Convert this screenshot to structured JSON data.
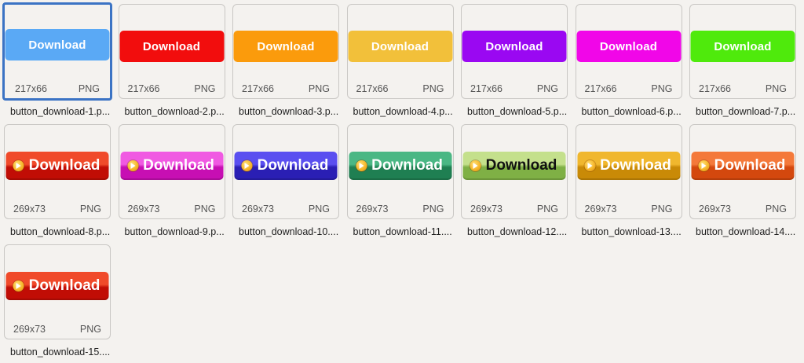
{
  "files": [
    {
      "name": "button_download-1.p...",
      "dims": "217x66",
      "type": "PNG",
      "label": "Download",
      "style": "flat",
      "bg": "#5aa9f5",
      "selected": true
    },
    {
      "name": "button_download-2.p...",
      "dims": "217x66",
      "type": "PNG",
      "label": "Download",
      "style": "flat",
      "bg": "#f20d0d"
    },
    {
      "name": "button_download-3.p...",
      "dims": "217x66",
      "type": "PNG",
      "label": "Download",
      "style": "flat",
      "bg": "#fb9b0c"
    },
    {
      "name": "button_download-4.p...",
      "dims": "217x66",
      "type": "PNG",
      "label": "Download",
      "style": "flat",
      "bg": "#f2c03a"
    },
    {
      "name": "button_download-5.p...",
      "dims": "217x66",
      "type": "PNG",
      "label": "Download",
      "style": "flat",
      "bg": "#9a08f2"
    },
    {
      "name": "button_download-6.p...",
      "dims": "217x66",
      "type": "PNG",
      "label": "Download",
      "style": "flat",
      "bg": "#f106e8"
    },
    {
      "name": "button_download-7.p...",
      "dims": "217x66",
      "type": "PNG",
      "label": "Download",
      "style": "flat",
      "bg": "#4fea0c"
    },
    {
      "name": "button_download-8.p...",
      "dims": "269x73",
      "type": "PNG",
      "label": "Download",
      "style": "glossy",
      "top": "#f04a2a",
      "bottom": "#c10d05",
      "text": "#ffffff"
    },
    {
      "name": "button_download-9.p...",
      "dims": "269x73",
      "type": "PNG",
      "label": "Download",
      "style": "glossy",
      "top": "#f05ae2",
      "bottom": "#c70fb3",
      "text": "#ffffff"
    },
    {
      "name": "button_download-10....",
      "dims": "269x73",
      "type": "PNG",
      "label": "Download",
      "style": "glossy",
      "top": "#5a4ff0",
      "bottom": "#2a1fb4",
      "text": "#ffffff"
    },
    {
      "name": "button_download-11....",
      "dims": "269x73",
      "type": "PNG",
      "label": "Download",
      "style": "glossy",
      "top": "#4ab784",
      "bottom": "#1f7f52",
      "text": "#ffffff"
    },
    {
      "name": "button_download-12....",
      "dims": "269x73",
      "type": "PNG",
      "label": "Download",
      "style": "glossy",
      "top": "#c4e08c",
      "bottom": "#7fb045",
      "text": "#111111"
    },
    {
      "name": "button_download-13....",
      "dims": "269x73",
      "type": "PNG",
      "label": "Download",
      "style": "glossy",
      "top": "#f0b72e",
      "bottom": "#c98a07",
      "text": "#ffffff"
    },
    {
      "name": "button_download-14....",
      "dims": "269x73",
      "type": "PNG",
      "label": "Download",
      "style": "glossy",
      "top": "#f4793a",
      "bottom": "#d4480e",
      "text": "#ffffff"
    },
    {
      "name": "button_download-15....",
      "dims": "269x73",
      "type": "PNG",
      "label": "Download",
      "style": "glossy",
      "top": "#f04a2a",
      "bottom": "#c10d05",
      "text": "#ffffff"
    }
  ],
  "colors": {
    "selection_border": "#3b73c4",
    "thumb_border": "#c9c7c4",
    "background": "#f4f2ef"
  }
}
